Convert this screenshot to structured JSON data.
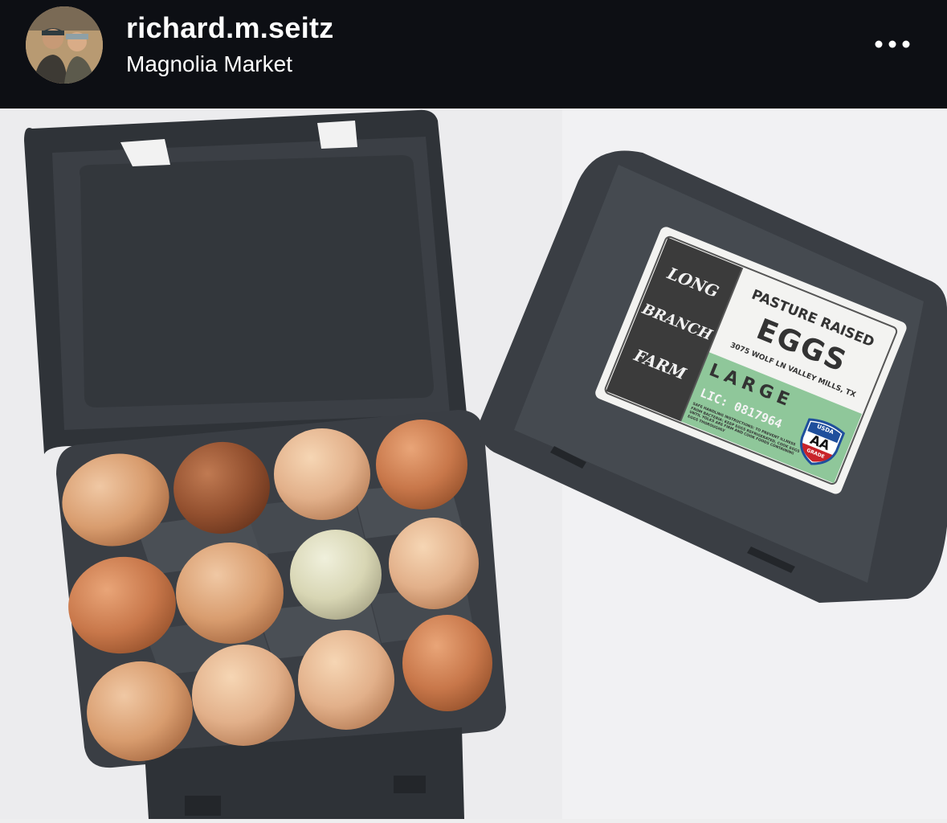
{
  "post": {
    "username": "richard.m.seitz",
    "location": "Magnolia Market",
    "more_icon": "more-horizontal-icon"
  },
  "label": {
    "farm_line1": "LONG",
    "farm_line2": "BRANCH",
    "farm_line3": "FARM",
    "product_line1": "PASTURE RAISED",
    "product_line2": "EGGS",
    "address": "3075 WOLF LN VALLEY MILLS, TX",
    "size": "LARGE",
    "license": "LIC: 0817964",
    "grade_top": "USDA",
    "grade": "AA",
    "grade_bottom": "GRADE",
    "handling": "SAFE HANDLING INSTRUCTIONS: TO PREVENT ILLNESS FROM BACTERIA: KEEP EGGS REFRIGERATED, COOK EGGS UNTIL YOLKS ARE FIRM AND COOK FOODS CONTAINING EGGS THOROUGHLY"
  },
  "colors": {
    "header_bg": "#0d0f14",
    "carton": "#3d4147",
    "label_green": "#8fc79a",
    "shield_red": "#c8232a",
    "shield_blue": "#1f4f9c"
  }
}
